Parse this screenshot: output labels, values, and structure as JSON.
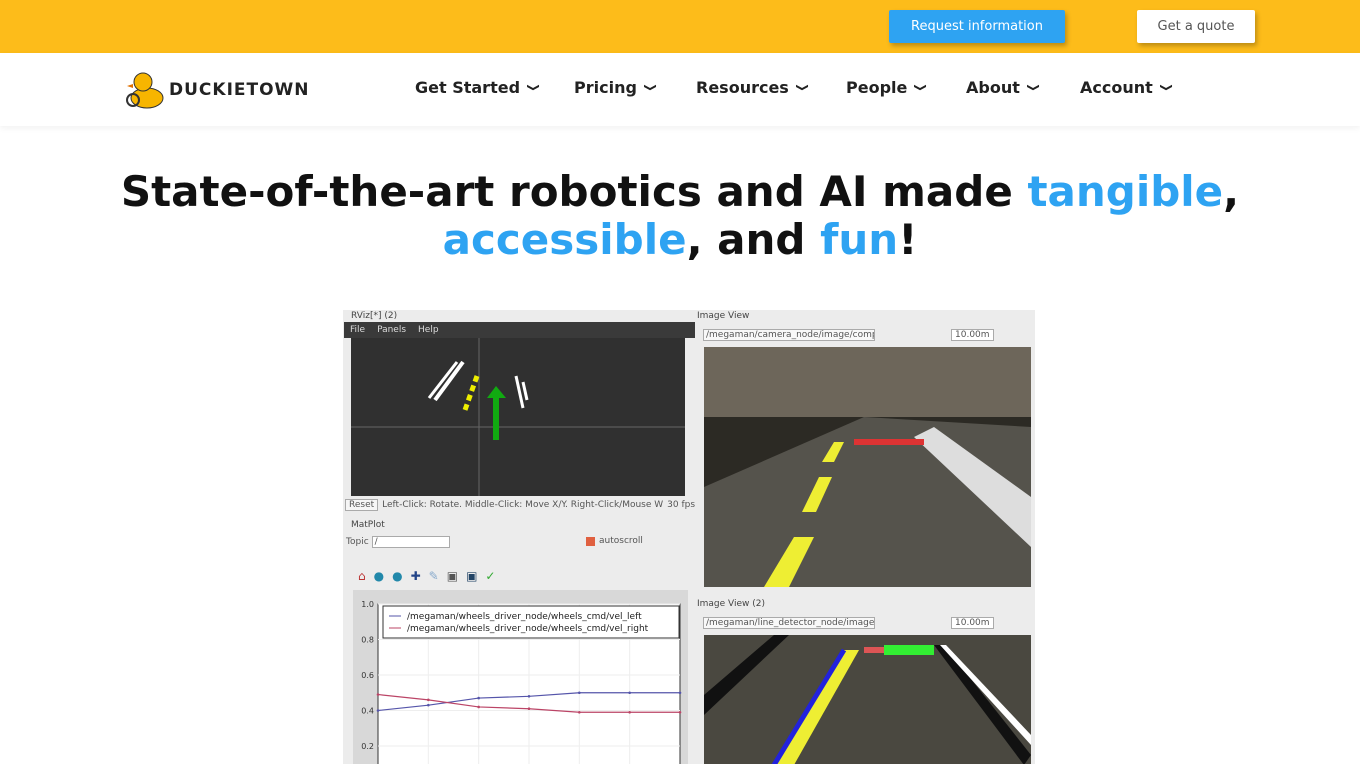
{
  "topbar": {
    "request_info": "Request information",
    "get_quote": "Get a quote"
  },
  "logo": {
    "text": "DUCKIETOWN"
  },
  "nav": [
    {
      "label": "Get Started"
    },
    {
      "label": "Pricing"
    },
    {
      "label": "Resources"
    },
    {
      "label": "People"
    },
    {
      "label": "About"
    },
    {
      "label": "Account"
    }
  ],
  "headline": {
    "part1": "State-of-the-art robotics and AI made ",
    "w1": "tangible",
    "p2": ",",
    "w2": "accessible",
    "p3": ", and ",
    "w3": "fun",
    "p4": "!"
  },
  "colors": {
    "accent": "#2ea3f2",
    "topbar": "#fdbc1a"
  },
  "screenshot": {
    "rviz_title": "RViz[*] (2)",
    "rviz_menu": [
      "File",
      "Panels",
      "Help"
    ],
    "rviz_status": "Left-Click: Rotate. Middle-Click: Move X/Y. Right-Click/Mouse W",
    "reset": "Reset",
    "fps": "30 fps",
    "matplot_title": "MatPlot",
    "topic_label": "Topic",
    "topic_value": "/",
    "autoscroll": "autoscroll",
    "imgview1_title": "Image View",
    "imgview1_topic": "/megaman/camera_node/image/comp",
    "imgview1_time": "10.00m",
    "imgview2_title": "Image View (2)",
    "imgview2_topic": "/megaman/line_detector_node/image",
    "imgview2_time": "10.00m"
  },
  "chart_data": {
    "type": "line",
    "x": [
      0,
      1,
      2,
      3,
      4,
      5,
      6
    ],
    "series": [
      {
        "name": "/megaman/wheels_driver_node/wheels_cmd/vel_left",
        "color": "#5555aa",
        "values": [
          0.4,
          0.43,
          0.47,
          0.48,
          0.5,
          0.5,
          0.5
        ]
      },
      {
        "name": "/megaman/wheels_driver_node/wheels_cmd/vel_right",
        "color": "#bb4466",
        "values": [
          0.49,
          0.46,
          0.42,
          0.41,
          0.39,
          0.39,
          0.39
        ]
      }
    ],
    "yticks": [
      "1.0",
      "0.8",
      "0.6",
      "0.4",
      "0.2"
    ],
    "ylim": [
      0.2,
      1.0
    ],
    "grid": true,
    "legend": "top"
  }
}
